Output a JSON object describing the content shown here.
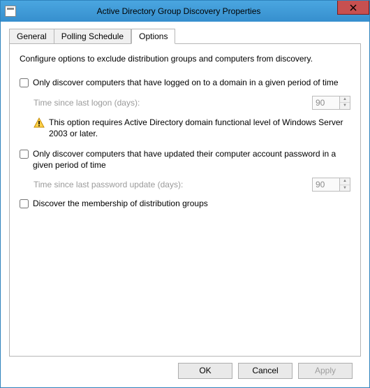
{
  "window": {
    "title": "Active Directory Group Discovery Properties"
  },
  "tabs": {
    "general": "General",
    "polling": "Polling Schedule",
    "options": "Options",
    "selected": "options"
  },
  "options": {
    "intro": "Configure options to exclude distribution groups and computers from discovery.",
    "opt1": {
      "label": "Only discover computers that have logged on to a domain in a given period of time",
      "checked": false,
      "sublabel": "Time since last logon (days):",
      "value": "90",
      "warning": "This option requires Active Directory domain functional level of Windows Server 2003 or later."
    },
    "opt2": {
      "label": "Only discover computers that have updated their computer account password in a given period of time",
      "checked": false,
      "sublabel": "Time since last password update (days):",
      "value": "90"
    },
    "opt3": {
      "label": "Discover the membership of distribution groups",
      "checked": false
    }
  },
  "buttons": {
    "ok": "OK",
    "cancel": "Cancel",
    "apply": "Apply"
  }
}
